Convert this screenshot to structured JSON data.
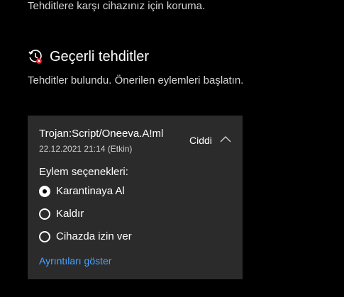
{
  "top_subtitle": "Tehditlere karşı cihazınız için koruma.",
  "section": {
    "icon": "history-alert-icon",
    "title": "Geçerli tehditler",
    "description": "Tehditler bulundu. Önerilen eylemleri başlatın."
  },
  "threat": {
    "name": "Trojan:Script/Oneeva.A!ml",
    "date": "22.12.2021 21:14 (Etkin)",
    "severity": "Ciddi",
    "actions_label": "Eylem seçenekleri:",
    "options": [
      {
        "label": "Karantinaya Al",
        "selected": true
      },
      {
        "label": "Kaldır",
        "selected": false
      },
      {
        "label": "Cihazda izin ver",
        "selected": false
      }
    ],
    "details_link": "Ayrıntıları göster"
  },
  "colors": {
    "background": "#000000",
    "card": "#2b2b2b",
    "link": "#4aa3ff",
    "alert_red": "#e81123"
  }
}
